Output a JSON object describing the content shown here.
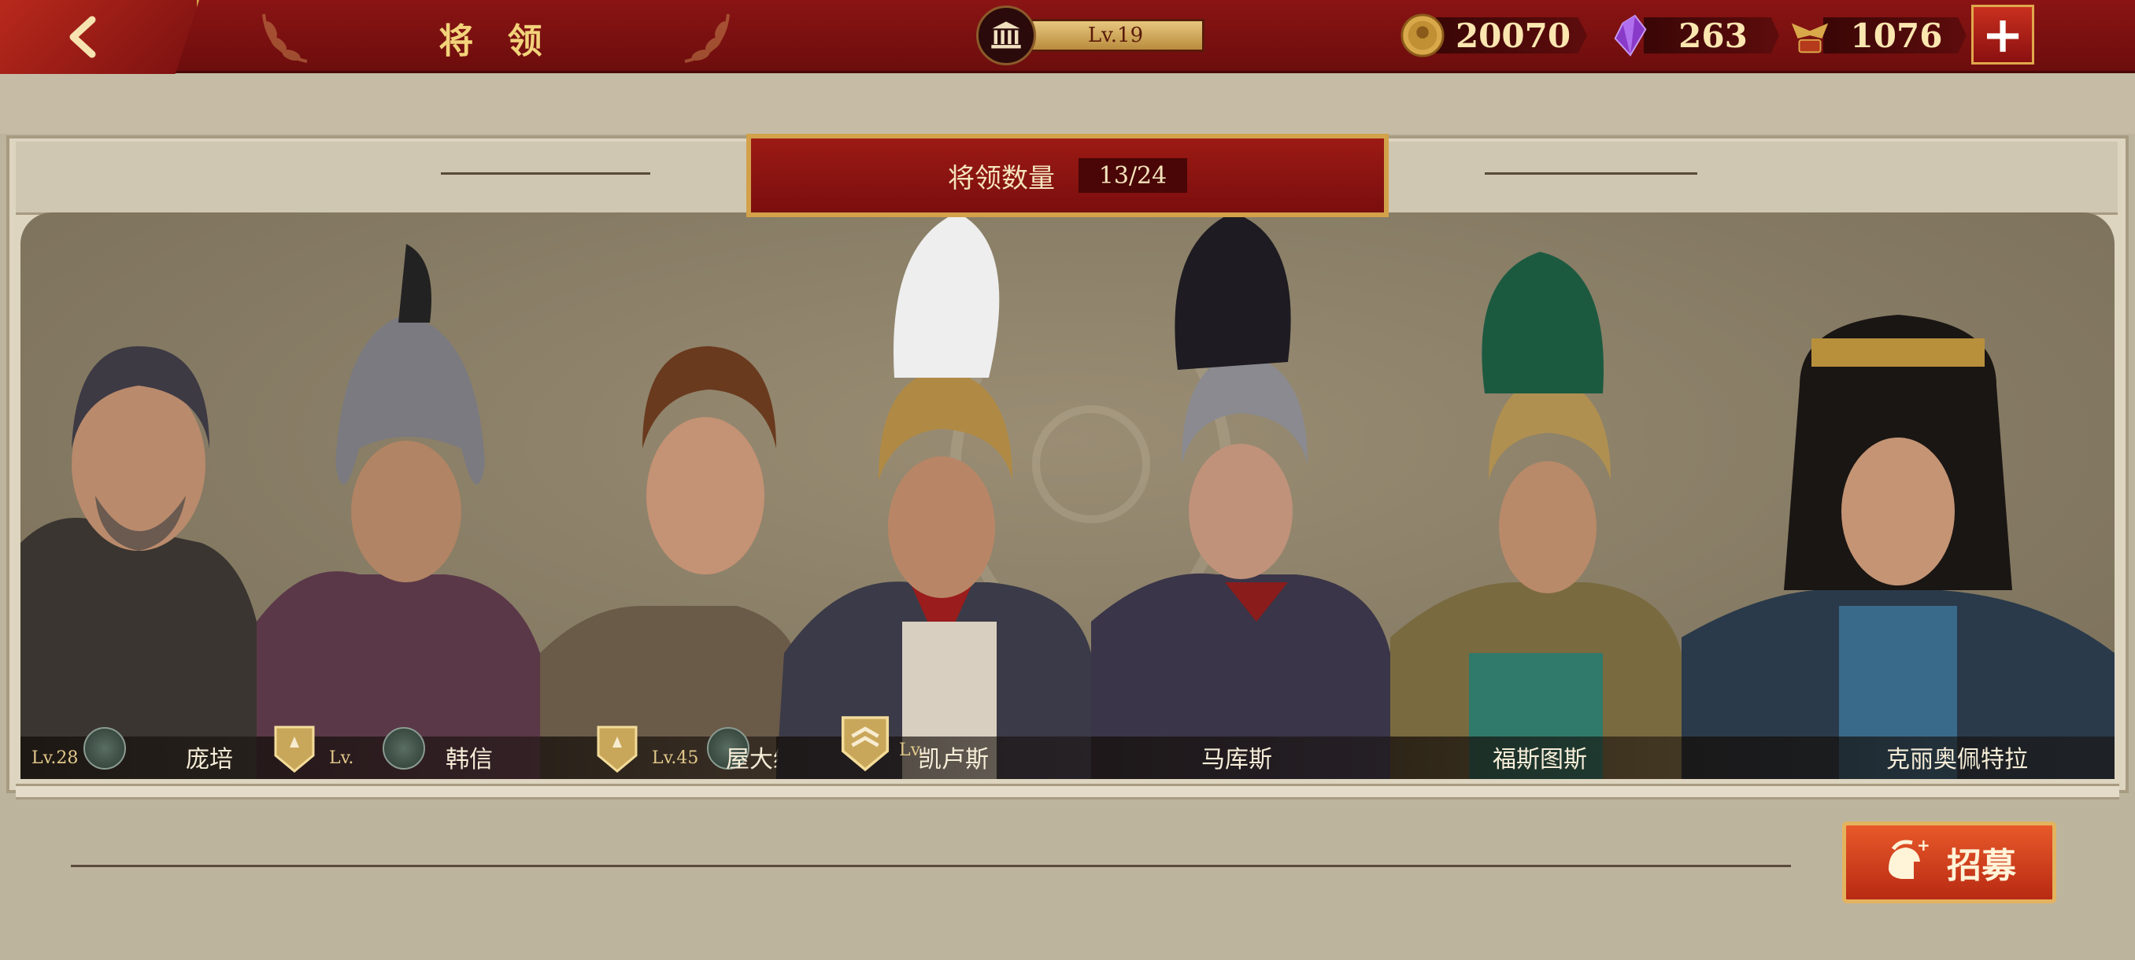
{
  "header": {
    "back_icon": "back-arrow-icon",
    "title": "将 领",
    "level": "Lv.19",
    "resources": [
      {
        "icon": "gold-coin-icon",
        "value": "20070"
      },
      {
        "icon": "purple-gem-icon",
        "value": "263"
      },
      {
        "icon": "spqr-eagle-icon",
        "value": "1076"
      }
    ],
    "plus_icon": "plus-icon"
  },
  "banner": {
    "label": "将领数量",
    "count": "13/24"
  },
  "generals": [
    {
      "level": "Lv.28",
      "name": "庞培"
    },
    {
      "level": "Lv.",
      "name": "韩信"
    },
    {
      "level": "Lv.45",
      "name": "屋大维"
    },
    {
      "level": "Lv.",
      "name": "凯卢斯"
    },
    {
      "level": "",
      "name": "马库斯"
    },
    {
      "level": "",
      "name": "福斯图斯"
    },
    {
      "level": "",
      "name": "克丽奥佩特拉"
    }
  ],
  "recruit": {
    "label": "招募",
    "icon": "spartan-helmet-plus-icon"
  },
  "colors": {
    "topbar": "#7a1010",
    "gold": "#f2d37a",
    "frame": "#ddd5c0",
    "gallery": "#857a63",
    "recruit": "#d4421e"
  }
}
